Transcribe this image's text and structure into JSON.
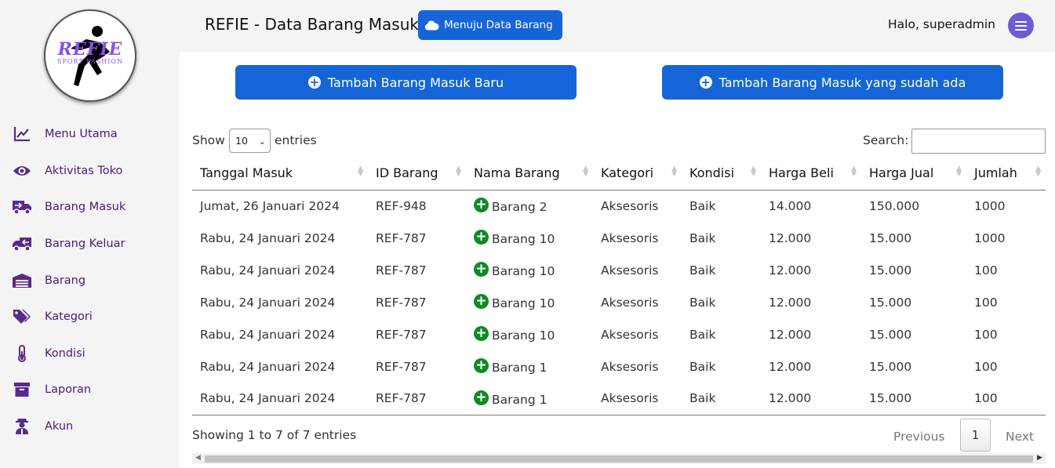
{
  "sidebar": {
    "logo": {
      "brand": "REFIE",
      "tagline": "SPORT FASHION"
    },
    "items": [
      {
        "label": "Menu Utama",
        "icon": "chart-line-icon"
      },
      {
        "label": "Aktivitas Toko",
        "icon": "eye-icon"
      },
      {
        "label": "Barang Masuk",
        "icon": "truck-in-icon"
      },
      {
        "label": "Barang Keluar",
        "icon": "truck-out-icon"
      },
      {
        "label": "Barang",
        "icon": "warehouse-icon"
      },
      {
        "label": "Kategori",
        "icon": "tags-icon"
      },
      {
        "label": "Kondisi",
        "icon": "thermometer-icon"
      },
      {
        "label": "Laporan",
        "icon": "archive-icon"
      },
      {
        "label": "Akun",
        "icon": "user-icon"
      }
    ]
  },
  "header": {
    "title": "REFIE - Data Barang Masuk",
    "goto_button": "Menuju Data Barang",
    "greeting": "Halo, superadmin"
  },
  "actions": {
    "add_new": "Tambah Barang Masuk Baru",
    "add_existing": "Tambah Barang Masuk yang sudah ada"
  },
  "table_controls": {
    "show_label": "Show",
    "entries_value": "10",
    "entries_label": "entries",
    "search_label": "Search:",
    "search_value": ""
  },
  "table": {
    "columns": [
      "Tanggal Masuk",
      "ID Barang",
      "Nama Barang",
      "Kategori",
      "Kondisi",
      "Harga Beli",
      "Harga Jual",
      "Jumlah"
    ],
    "rows": [
      [
        "Jumat, 26 Januari 2024",
        "REF-948",
        "Barang 2",
        "Aksesoris",
        "Baik",
        "14.000",
        "150.000",
        "1000"
      ],
      [
        "Rabu, 24 Januari 2024",
        "REF-787",
        "Barang 10",
        "Aksesoris",
        "Baik",
        "12.000",
        "15.000",
        "1000"
      ],
      [
        "Rabu, 24 Januari 2024",
        "REF-787",
        "Barang 10",
        "Aksesoris",
        "Baik",
        "12.000",
        "15.000",
        "100"
      ],
      [
        "Rabu, 24 Januari 2024",
        "REF-787",
        "Barang 10",
        "Aksesoris",
        "Baik",
        "12.000",
        "15.000",
        "100"
      ],
      [
        "Rabu, 24 Januari 2024",
        "REF-787",
        "Barang 10",
        "Aksesoris",
        "Baik",
        "12.000",
        "15.000",
        "100"
      ],
      [
        "Rabu, 24 Januari 2024",
        "REF-787",
        "Barang 1",
        "Aksesoris",
        "Baik",
        "12.000",
        "15.000",
        "100"
      ],
      [
        "Rabu, 24 Januari 2024",
        "REF-787",
        "Barang 1",
        "Aksesoris",
        "Baik",
        "12.000",
        "15.000",
        "100"
      ]
    ]
  },
  "footer": {
    "info": "Showing 1 to 7 of 7 entries",
    "previous": "Previous",
    "current_page": "1",
    "next": "Next"
  },
  "colors": {
    "primary": "#1565d8",
    "sidebar_text": "#4a1a7a",
    "icon": "#5a2a8a",
    "add_green": "#0f8a24",
    "menu_button": "#6c5bd2"
  }
}
